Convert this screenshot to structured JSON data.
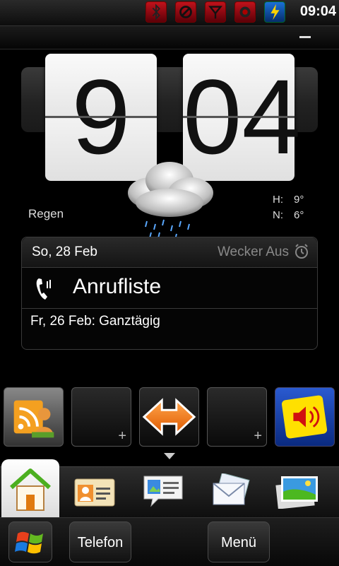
{
  "status_bar": {
    "time": "09:04",
    "icons": [
      "bluetooth-icon",
      "no-signal-icon",
      "antenna-icon",
      "media-record-icon",
      "charging-icon"
    ]
  },
  "clock": {
    "hour": "9",
    "minute": "04"
  },
  "weather": {
    "condition": "Regen",
    "high_label": "H:",
    "high_value": "9°",
    "low_label": "N:",
    "low_value": "6°",
    "icon": "rain-cloud-icon"
  },
  "info_panel": {
    "date": "So, 28 Feb",
    "alarm": "Wecker Aus",
    "call_log": "Anrufliste",
    "event": "Fr, 26 Feb: Ganztägig"
  },
  "shortcuts": [
    {
      "icon": "rss-feed-icon"
    },
    {
      "icon": "add-shortcut",
      "plus": "+"
    },
    {
      "icon": "navigation-icon"
    },
    {
      "icon": "add-shortcut",
      "plus": "+"
    },
    {
      "icon": "volume-icon"
    }
  ],
  "tabs": [
    {
      "icon": "home-icon",
      "selected": true
    },
    {
      "icon": "contacts-icon"
    },
    {
      "icon": "messaging-icon"
    },
    {
      "icon": "mail-icon"
    },
    {
      "icon": "photos-icon"
    }
  ],
  "bottom_bar": {
    "start_icon": "windows-start-icon",
    "phone_label": "Telefon",
    "menu_label": "Menü"
  }
}
